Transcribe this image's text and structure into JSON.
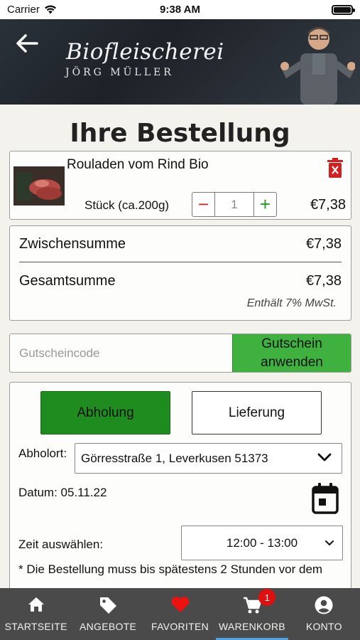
{
  "status": {
    "carrier": "Carrier",
    "time": "9:38 AM"
  },
  "header": {
    "brand_line1": "Biofleischerei",
    "brand_line2": "JÖRG MÜLLER"
  },
  "title": "Ihre Bestellung",
  "product": {
    "name": "Rouladen vom Rind Bio",
    "unit": "Stück (ca.200g)",
    "quantity": "1",
    "price": "€7,38"
  },
  "totals": {
    "subtotal_label": "Zwischensumme",
    "subtotal": "€7,38",
    "total_label": "Gesamtsumme",
    "total": "€7,38",
    "vat_note": "Enthält 7% MwSt."
  },
  "coupon": {
    "placeholder": "Gutscheincode",
    "apply_line1": "Gutschein",
    "apply_line2": "anwenden"
  },
  "delivery": {
    "pickup_label": "Abholung",
    "delivery_label": "Lieferung",
    "location_label": "Abholort:",
    "location_value": "Görresstraße 1, Leverkusen 51373",
    "date_text": "Datum: 05.11.22",
    "time_label": "Zeit auswählen:",
    "time_value": "12:00 - 13:00",
    "note": "* Die Bestellung muss bis spätestens 2 Stunden vor dem"
  },
  "tabs": [
    {
      "label": "STARTSEITE",
      "icon": "home-icon"
    },
    {
      "label": "ANGEBOTE",
      "icon": "tag-icon"
    },
    {
      "label": "FAVORITEN",
      "icon": "heart-icon"
    },
    {
      "label": "WARENKORB",
      "icon": "cart-icon",
      "badge": "1"
    },
    {
      "label": "KONTO",
      "icon": "account-icon"
    }
  ],
  "colors": {
    "accent_green": "#1f8c1f",
    "coupon_green": "#3eb13e",
    "danger_red": "#d12020",
    "tab_bg": "#4a4a4a",
    "active_underline": "#4aa3e0"
  }
}
